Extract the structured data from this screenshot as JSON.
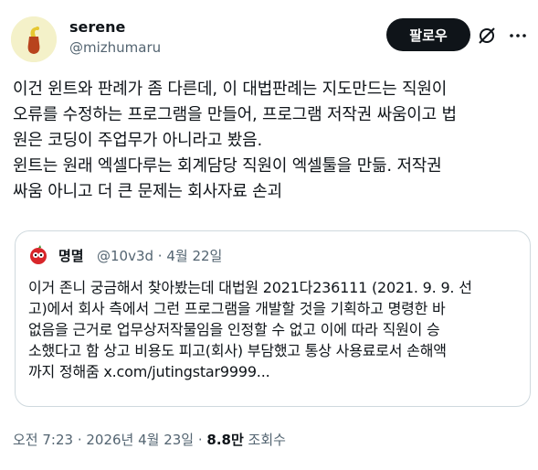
{
  "author": {
    "name": "serene",
    "handle": "@mizhumaru"
  },
  "follow_button": "팔로우",
  "tweet_text": "이건 윈트와 판례가 좀 다른데, 이 대법판례는 지도만드는 직원이\n오류를 수정하는 프로그램을 만들어, 프로그램 저작권 싸움이고 법\n원은 코딩이 주업무가 아니라고 봤음.\n윈트는 원래 엑셀다루는 회계담당 직원이 엑셀툴을 만듦. 저작권\n싸움 아니고 더 큰 문제는 회사자료 손괴",
  "quote": {
    "name": "명멸",
    "meta": "@10v3d · 4월 22일",
    "text": "이거 존니 궁금해서 찾아봤는데 대법원 2021다236111 (2021. 9. 9. 선\n고)에서 회사 측에서 그런 프로그램을 개발할 것을 기획하고 명령한 바\n없음을 근거로 업무상저작물임을 인정할 수 없고 이에 따라 직원이 승\n소했다고 함 상고 비용도 피고(회사) 부담했고 통상 사용료로서 손해액\n까지 정해줌 x.com/jutingstar9999..."
  },
  "footer": {
    "timestamp": "오전 7:23 · 2026년 4월 23일 · ",
    "views": "8.8만",
    "views_label": " 조회수"
  },
  "icons": {
    "grok": "grok-icon",
    "more": "more-icon"
  }
}
